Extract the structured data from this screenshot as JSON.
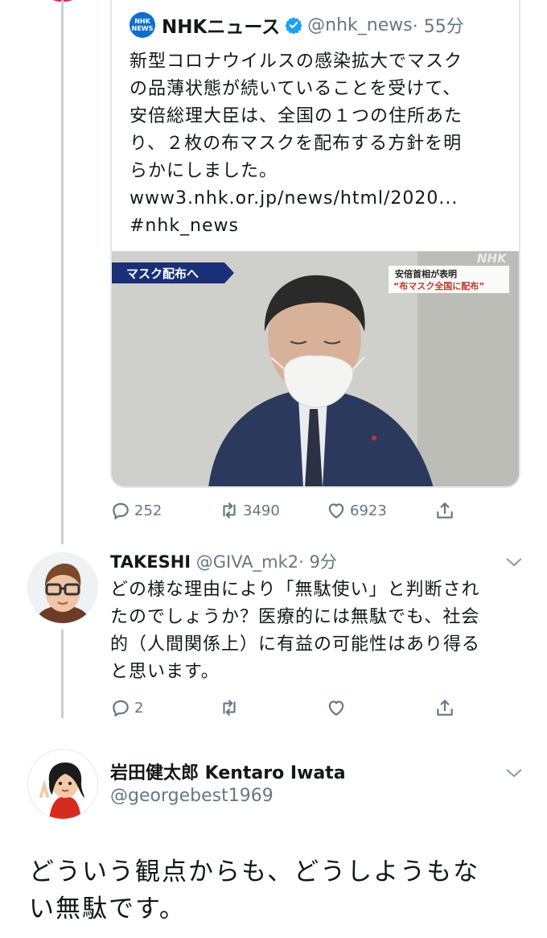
{
  "quoted_tweet": {
    "logo_top": "NHK",
    "logo_bottom": "NEWS",
    "author_name": "NHKニュース",
    "handle": "@nhk_news",
    "time": "· 55分",
    "text_lines": [
      "新型コロナウイルスの感染拡大でマスク",
      "の品薄状態が続いていることを受けて、",
      "安倍総理大臣は、全国の１つの住所あた",
      "り、２枚の布マスクを配布する方針を明",
      "らかにしました。",
      "www3.nhk.or.jp/news/html/2020...",
      "#nhk_news"
    ],
    "media": {
      "banner_left": "マスク配布へ",
      "banner_right_top": "安倍首相が表明",
      "banner_right_bottom": "“布マスク全国に配布”",
      "watermark": "NHK"
    },
    "actions": {
      "reply_count": "252",
      "retweet_count": "3490",
      "like_count": "6923"
    }
  },
  "reply_tweet": {
    "author_name": "TAKESHI",
    "handle": "@GIVA_mk2",
    "time": "· 9分",
    "text_lines": [
      "どの様な理由により「無駄使い」と判断され",
      "たのでしょうか？医療的には無駄でも、社会",
      "的（人間関係上）に有益の可能性はあり得る",
      "と思います。"
    ],
    "actions": {
      "reply_count": "2",
      "retweet_count": "",
      "like_count": ""
    }
  },
  "main_tweet": {
    "author_name": "岩田健太郎 Kentaro Iwata",
    "handle": "@georgebest1969",
    "text_lines": [
      "どういう観点からも、どうしようもな",
      "い無駄です。"
    ]
  },
  "colors": {
    "accent": "#1da1f2",
    "muted": "#657786",
    "thread_line": "#c4cfd6",
    "nhk_blue": "#0f6fd0"
  }
}
